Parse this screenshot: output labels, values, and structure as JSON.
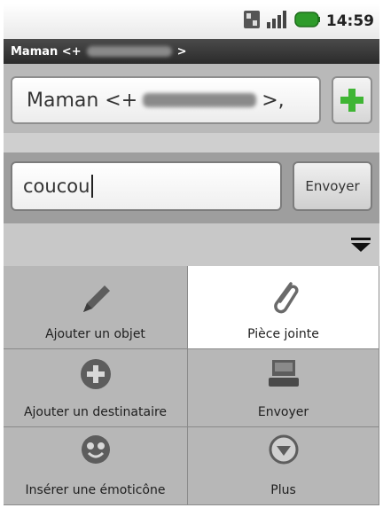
{
  "status_bar": {
    "time": "14:59",
    "icons": [
      "sync-icon",
      "signal-icon",
      "battery-icon"
    ]
  },
  "title_bar": {
    "prefix": "Maman <+",
    "suffix": ">"
  },
  "compose": {
    "to_prefix": "Maman <+",
    "to_suffix": ">,",
    "message_value": "coucou",
    "send_label": "Envoyer"
  },
  "menu": {
    "items": [
      {
        "label": "Ajouter un objet",
        "icon": "pencil-icon"
      },
      {
        "label": "Pièce jointe",
        "icon": "paperclip-icon"
      },
      {
        "label": "Ajouter un destinataire",
        "icon": "plus-circle-icon"
      },
      {
        "label": "Envoyer",
        "icon": "send-tray-icon"
      },
      {
        "label": "Insérer une émoticône",
        "icon": "smiley-icon"
      },
      {
        "label": "Plus",
        "icon": "chevron-down-circle-icon"
      }
    ]
  },
  "colors": {
    "accent_green": "#3fb534",
    "menu_bg": "#b7b7b7",
    "menu_active": "#ffffff"
  }
}
